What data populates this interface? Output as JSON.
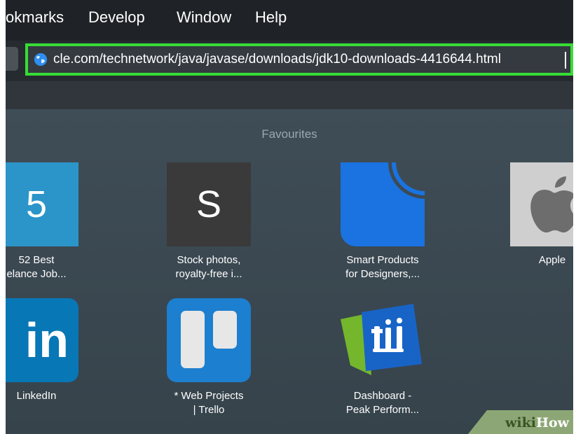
{
  "menubar": {
    "items": [
      "okmarks",
      "Develop",
      "Window",
      "Help"
    ]
  },
  "urlbar": {
    "url": "cle.com/technetwork/java/javase/downloads/jdk10-downloads-4416644.html"
  },
  "favourites": {
    "title": "Favourites",
    "tiles": [
      {
        "letter": "5",
        "line1": "52 Best",
        "line2": "elance Job...",
        "icon": "number-5-icon"
      },
      {
        "letter": "S",
        "line1": "Stock photos,",
        "line2": "royalty-free i...",
        "icon": "letter-s-icon"
      },
      {
        "line1": "Smart Products",
        "line2": "for Designers,...",
        "icon": "smart-products-logo"
      },
      {
        "line1": "Apple",
        "line2": "",
        "icon": "apple-logo"
      },
      {
        "letter": "in",
        "line1": "LinkedIn",
        "line2": "",
        "icon": "linkedin-logo"
      },
      {
        "line1": "* Web Projects",
        "line2": "| Trello",
        "icon": "trello-logo"
      },
      {
        "line1": "Dashboard -",
        "line2": "Peak Perform...",
        "icon": "dashboard-logo"
      }
    ]
  },
  "watermark": {
    "wiki": "wiki",
    "how": "How"
  },
  "colors": {
    "url_highlight": "#37dd37",
    "content_bg": "#3e4b54",
    "tile_5_bg": "#2b95c9",
    "tile_s_bg": "#3a3a3a",
    "smart_blue": "#1a73e0",
    "linkedin_blue": "#0877b6",
    "trello_blue": "#1d7fcf"
  }
}
